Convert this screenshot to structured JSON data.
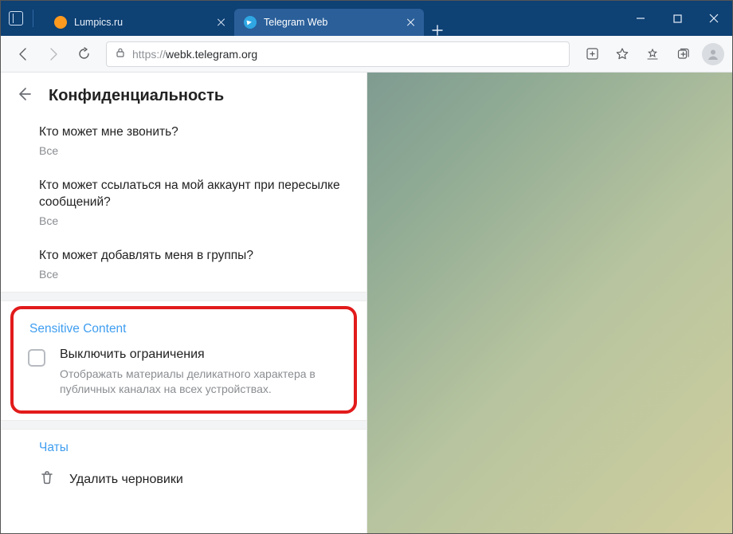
{
  "window": {
    "tabs": [
      {
        "title": "Lumpics.ru"
      },
      {
        "title": "Telegram Web"
      }
    ]
  },
  "addressbar": {
    "protocol": "https://",
    "host": "webk.telegram.org"
  },
  "pane": {
    "title": "Конфиденциальность",
    "rows": [
      {
        "label": "Кто может мне звонить?",
        "value": "Все"
      },
      {
        "label": "Кто может ссылаться на мой аккаунт при пересылке сообщений?",
        "value": "Все"
      },
      {
        "label": "Кто может добавлять меня в группы?",
        "value": "Все"
      }
    ],
    "sensitive": {
      "title": "Sensitive Content",
      "check_label": "Выключить ограничения",
      "check_desc": "Отображать материалы деликатного характера в публичных каналах на всех устройствах."
    },
    "chats": {
      "title": "Чаты",
      "delete_drafts": "Удалить черновики"
    }
  }
}
